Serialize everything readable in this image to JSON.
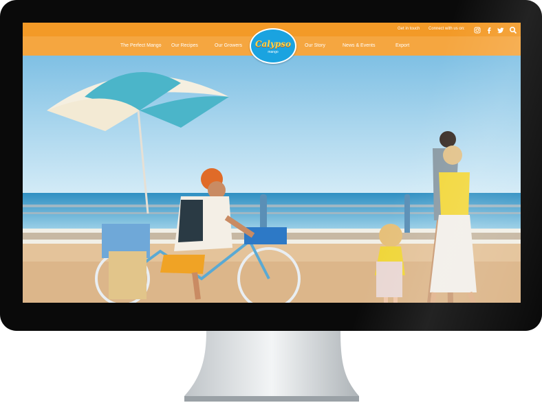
{
  "topbar": {
    "get_in_touch": "Get in touch",
    "connect": "Connect with us on:",
    "social_icons": [
      "instagram-icon",
      "facebook-icon",
      "twitter-icon",
      "search-icon"
    ]
  },
  "nav": {
    "items": [
      {
        "label": "The Perfect Mango"
      },
      {
        "label": "Our Recipes"
      },
      {
        "label": "Our Growers"
      },
      {
        "label": "Our Story"
      },
      {
        "label": "News & Events"
      },
      {
        "label": "Export"
      }
    ]
  },
  "logo": {
    "brand": "Calypso",
    "sub": "mango"
  },
  "colors": {
    "topbar": "#f39a27",
    "navbar": "#f5a640",
    "logo_blue": "#1aa3e0",
    "sky": "#8fc6e6",
    "sea": "#2f8fc2",
    "boardwalk": "#e4c39a"
  }
}
